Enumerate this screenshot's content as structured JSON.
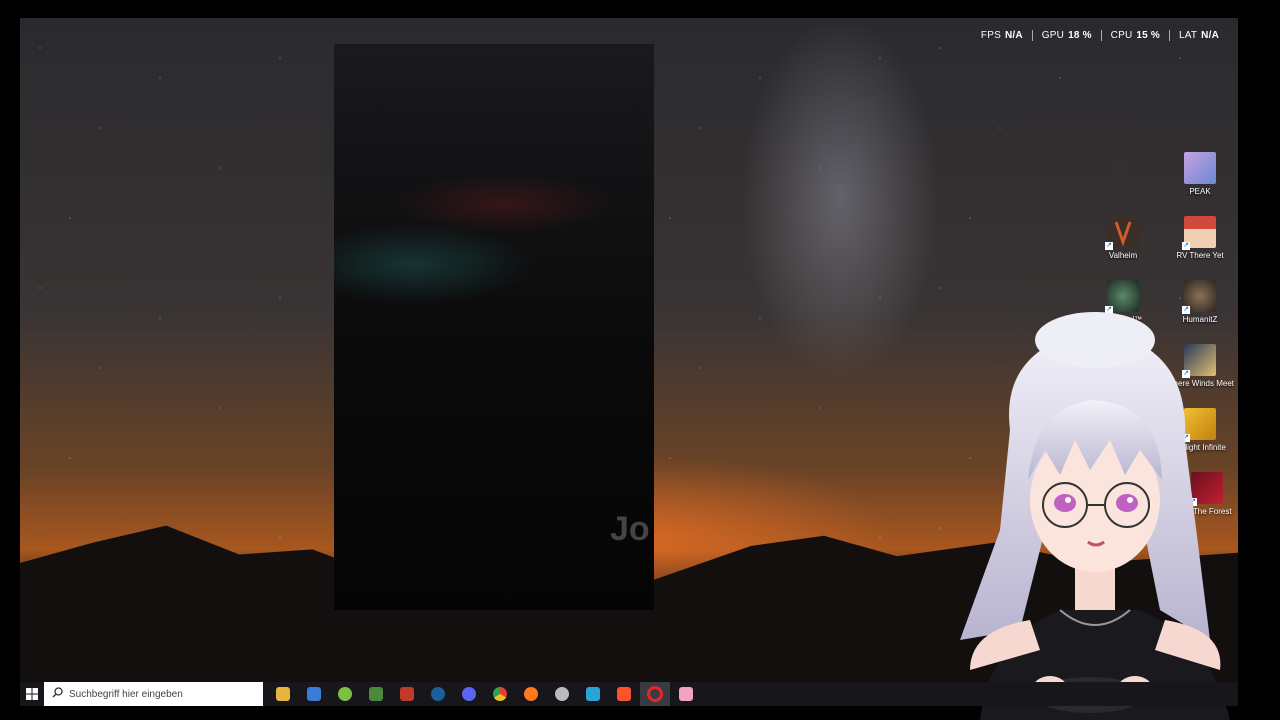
{
  "performance_overlay": {
    "fps": {
      "label": "FPS",
      "value": "N/A"
    },
    "gpu": {
      "label": "GPU",
      "value": "18 %"
    },
    "cpu": {
      "label": "CPU",
      "value": "15 %"
    },
    "lat": {
      "label": "LAT",
      "value": "N/A"
    }
  },
  "dark_window": {
    "partial_text": "Jo"
  },
  "desktop_icons": [
    {
      "label": "PEAK",
      "icon": "peak-icon",
      "color": "#7b8fd6"
    },
    {
      "label": "Valheim",
      "icon": "valheim-icon",
      "color": "#5a4a3a"
    },
    {
      "label": "RV There Yet",
      "icon": "rv-there-yet-icon",
      "color": "#b84a3a"
    },
    {
      "label": "Returnal™",
      "icon": "returnal-icon",
      "color": "#2e4a3a"
    },
    {
      "label": "HumanitZ",
      "icon": "humanitz-icon",
      "color": "#4a3f34"
    },
    {
      "label": "Where Winds Meet",
      "icon": "where-winds-meet-icon",
      "color": "#3a4a6a"
    },
    {
      "label": "rchlight Infinite",
      "icon": "torchlight-icon",
      "color": "#d8a520"
    },
    {
      "label": "Of The Forest",
      "icon": "forest-icon",
      "color": "#8a1a2a"
    }
  ],
  "taskbar": {
    "search_placeholder": "Suchbegriff hier eingeben",
    "apps": [
      {
        "name": "file-explorer",
        "color": "#e8b440"
      },
      {
        "name": "store",
        "color": "#3a7bd5"
      },
      {
        "name": "android-app",
        "color": "#7bc043"
      },
      {
        "name": "minecraft",
        "color": "#4a8a3a"
      },
      {
        "name": "brick-game",
        "color": "#c0392b"
      },
      {
        "name": "steam",
        "color": "#1b5f9e"
      },
      {
        "name": "discord",
        "color": "#5865f2"
      },
      {
        "name": "chrome",
        "color": "#e0a020"
      },
      {
        "name": "firefox",
        "color": "#ff7a1a"
      },
      {
        "name": "speed-monitor",
        "color": "#bbbbbb"
      },
      {
        "name": "sync-app",
        "color": "#2aa4d8"
      },
      {
        "name": "brave",
        "color": "#fb542b"
      },
      {
        "name": "opera",
        "color": "#e4262d"
      },
      {
        "name": "pink-app",
        "color": "#f4a0c0"
      }
    ]
  }
}
